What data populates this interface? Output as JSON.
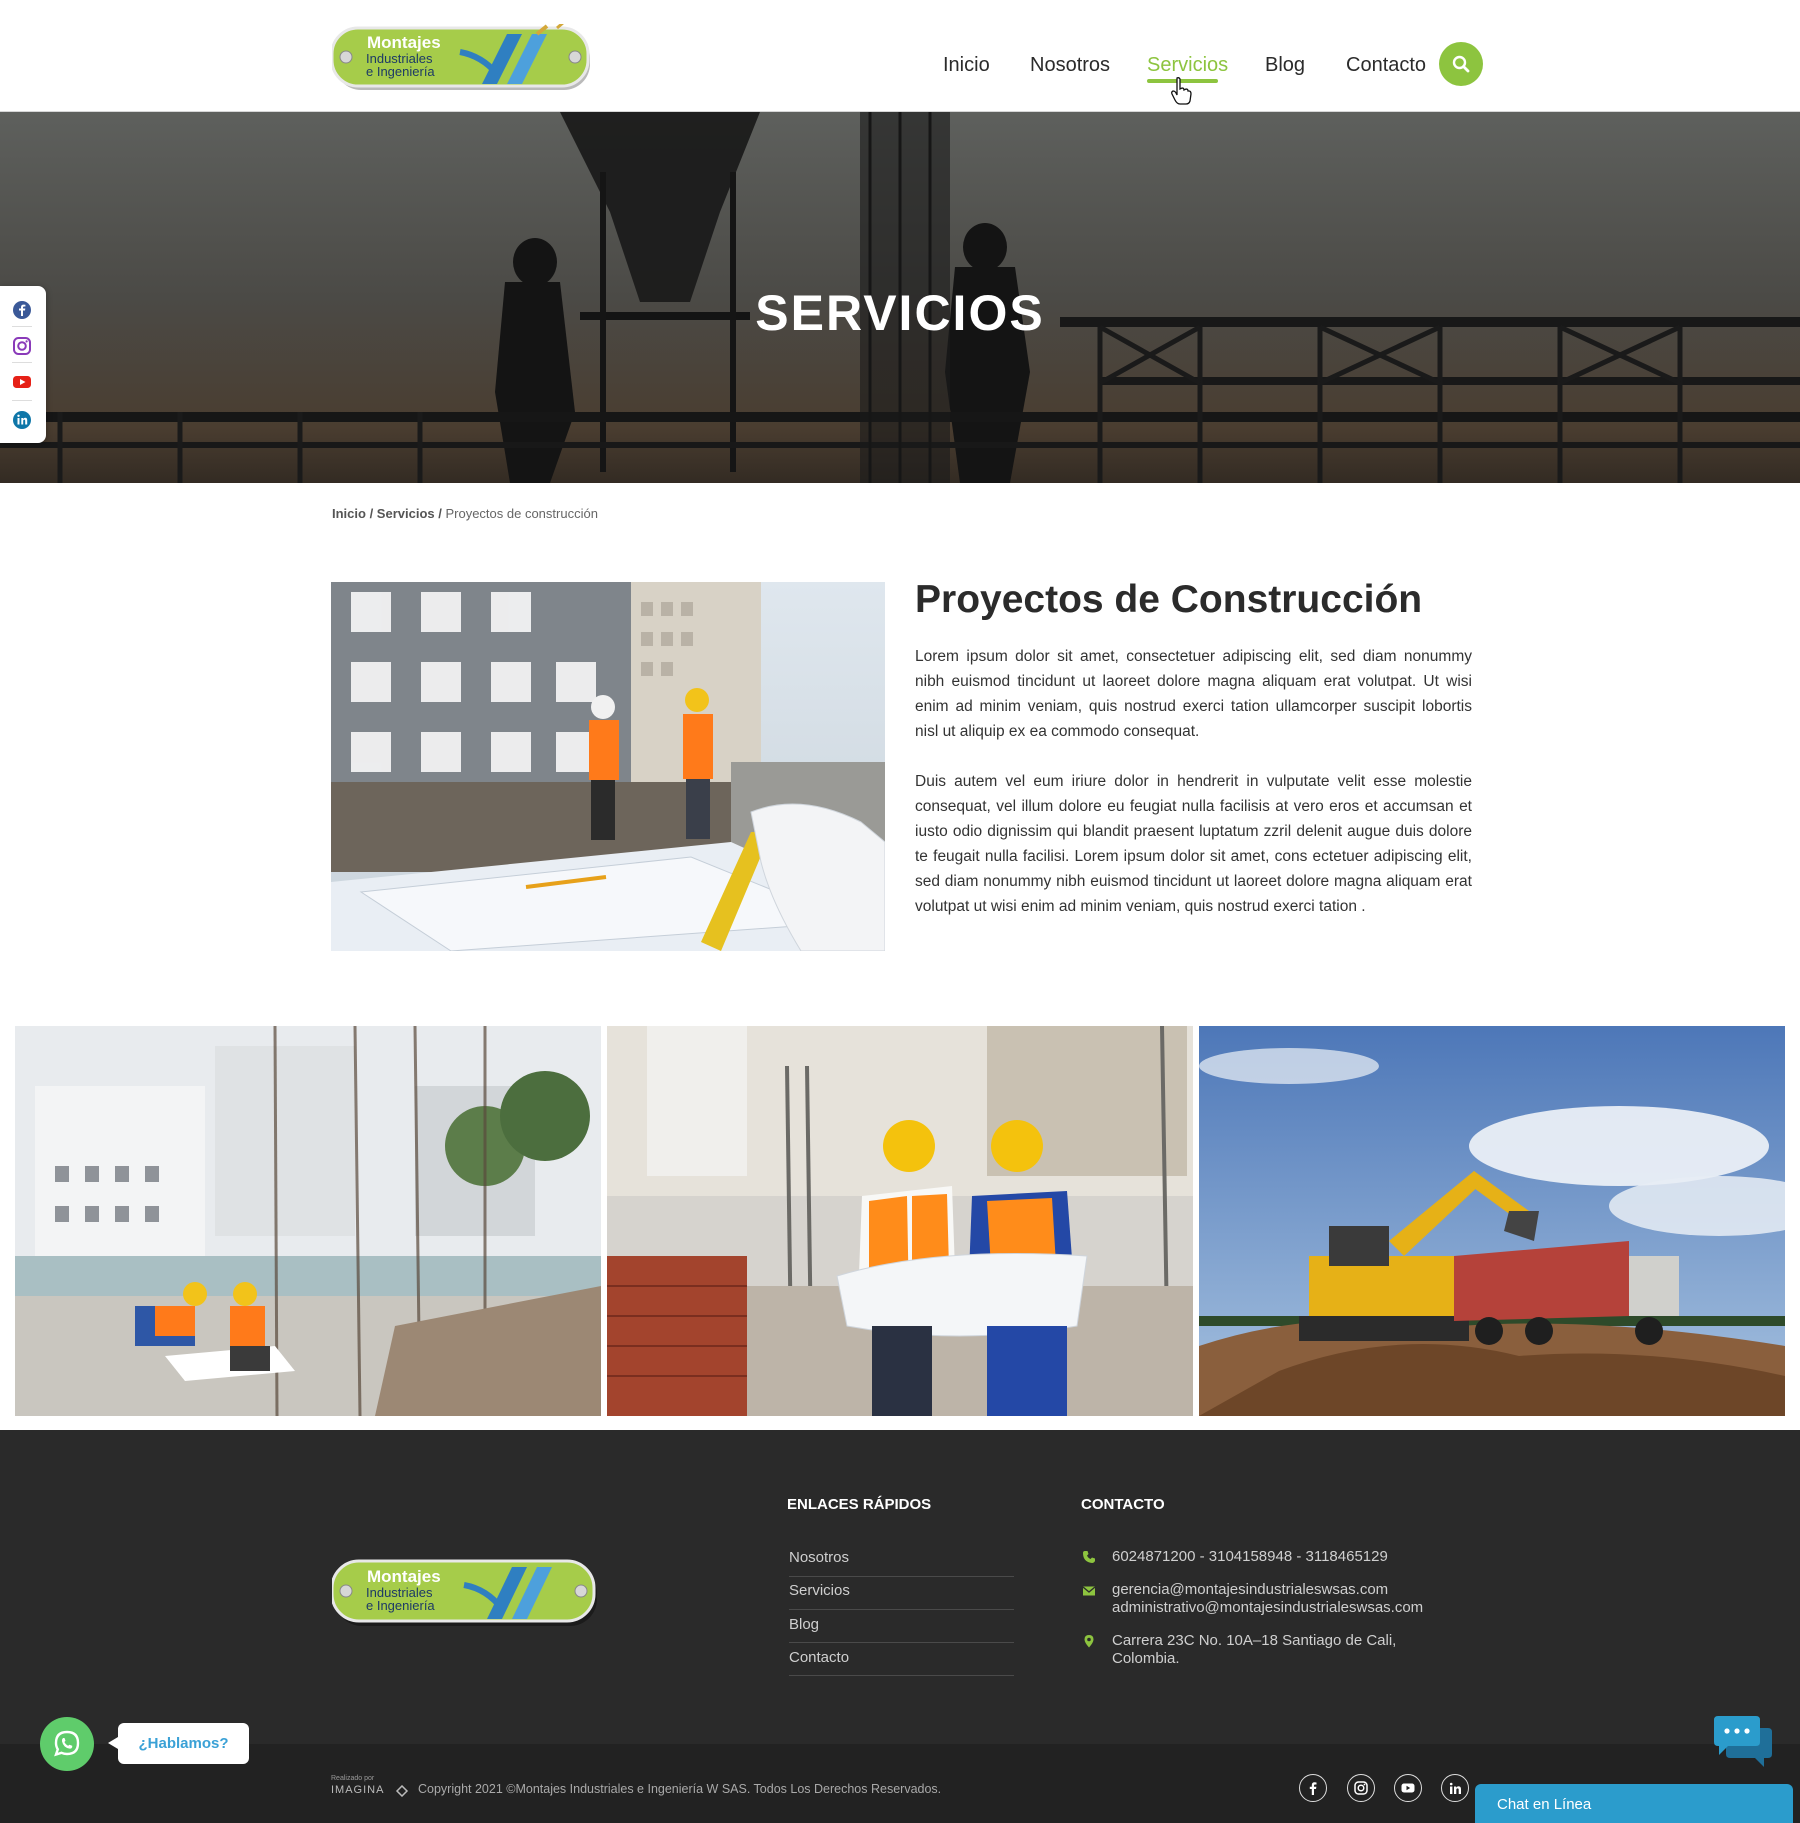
{
  "header": {
    "logo_line1": "Montajes",
    "logo_line2": "Industriales",
    "logo_line3": "e Ingeniería",
    "nav": [
      "Inicio",
      "Nosotros",
      "Servicios",
      "Blog",
      "Contacto"
    ],
    "active_nav": "Servicios"
  },
  "hero": {
    "title": "SERVICIOS"
  },
  "breadcrumb": {
    "home": "Inicio",
    "sep1": " / ",
    "section": "Servicios",
    "sep2": " / ",
    "current": "Proyectos de construcción"
  },
  "content": {
    "title": "Proyectos de Construcción",
    "paragraph1": "Lorem ipsum dolor sit amet, consectetuer adipiscing elit, sed diam nonummy nibh euismod tincidunt ut laoreet dolore magna aliquam erat volutpat. Ut wisi enim ad minim veniam, quis nostrud exerci tation ullamcorper suscipit lobortis nisl ut aliquip ex ea commodo consequat.",
    "paragraph2": "Duis autem vel eum iriure dolor in hendrerit in vulputate velit esse molestie consequat, vel illum dolore eu feugiat nulla facilisis at vero eros et accumsan et iusto odio dignissim qui blandit praesent luptatum zzril delenit augue duis dolore te feugait nulla facilisi. Lorem ipsum dolor sit amet, cons ectetuer adipiscing elit, sed diam nonummy nibh euismod tincidunt ut laoreet dolore magna aliquam erat volutpat ut wisi enim ad minim veniam, quis nostrud exerci tation ."
  },
  "footer": {
    "links_heading": "ENLACES RÁPIDOS",
    "links": [
      "Nosotros",
      "Servicios",
      "Blog",
      "Contacto"
    ],
    "contact_heading": "CONTACTO",
    "phone": "6024871200 - 3104158948 - 3118465129",
    "email1": "gerencia@montajesindustrialeswsas.com",
    "email2": "administrativo@montajesindustrialeswsas.com",
    "address_line1": "Carrera 23C No. 10A–18 Santiago de Cali,",
    "address_line2": "Colombia.",
    "realizado": "Realizado por",
    "imagina": "IMAGINA",
    "copyright": "Copyright 2021 ©Montajes Industriales e Ingeniería W SAS. Todos Los Derechos Reservados."
  },
  "widgets": {
    "whatsapp_label": "¿Hablamos?",
    "chat_label": "Chat en Línea"
  },
  "colors": {
    "accent": "#8dc43f",
    "footer_bg": "#2a2a2a",
    "chat_blue": "#2b9ccc",
    "whatsapp_green": "#5fcc6b"
  }
}
